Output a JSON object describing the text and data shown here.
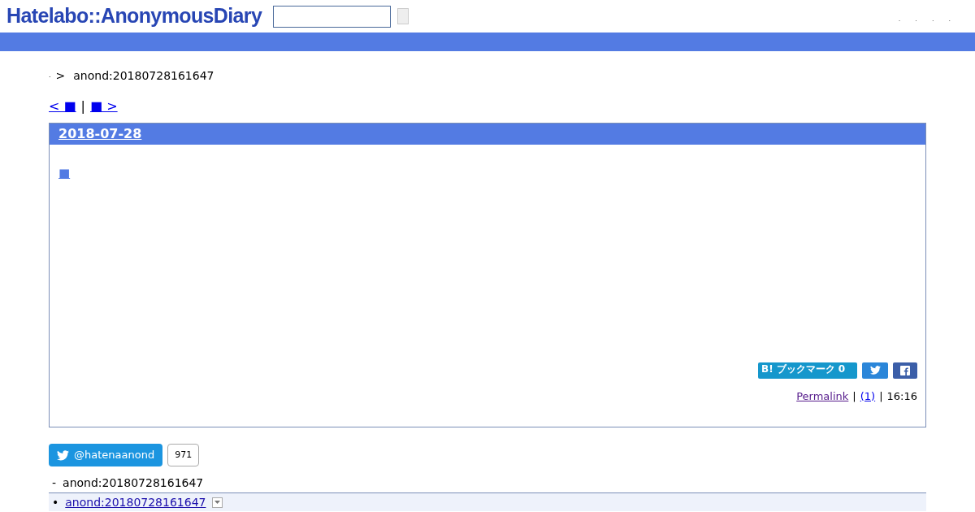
{
  "header": {
    "logo": "Hatelabo::AnonymousDiary",
    "links": [
      ".",
      ".",
      ".",
      "."
    ]
  },
  "breadcrumb": {
    "home": ".",
    "separator": ">",
    "current": "anond:20180728161647"
  },
  "pager": {
    "prev": "< ■",
    "separator": "|",
    "next": "■ >"
  },
  "entry": {
    "date": "2018-07-28",
    "title": "■",
    "bookmark": {
      "label": "B! ブックマーク",
      "count": "0"
    },
    "permalink": "Permalink",
    "separator": "|",
    "comments": "(1)",
    "time": "16:16"
  },
  "twitter": {
    "handle": "@hatenaanond",
    "followers": "971"
  },
  "tree": {
    "marker": "-",
    "root": "anond:20180728161647",
    "children": [
      {
        "bullet": "•",
        "label": "anond:20180728161647"
      }
    ]
  }
}
